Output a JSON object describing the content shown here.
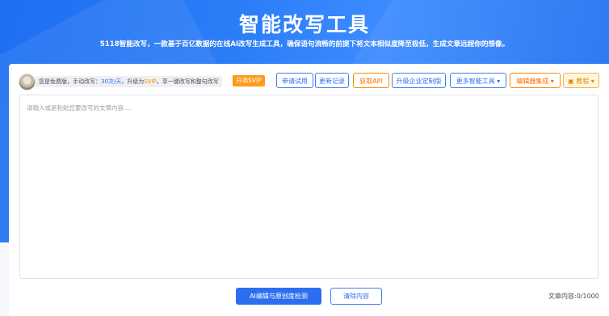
{
  "header": {
    "title": "智能改写工具",
    "subtitle": "5118智能改写，一款基于百亿数据的在线AI改写生成工具，确保语句流畅的前提下将文本相似度降至极低，生成文章远超你的想像。"
  },
  "notice": {
    "prefix": "您是免费版，手动改写：",
    "quota": "30次/天",
    "mid": "，升级为",
    "vip": "SVIP",
    "suffix": "，享一键改写和整句改写"
  },
  "toolbar": {
    "open_vip": "开通SVIP",
    "apply_trial": "申请试用",
    "changelog": "更新记录",
    "get_api": "获取API",
    "enterprise": "升级企业定制版",
    "more_tools": "更多智能工具",
    "editor_integration": "编辑器集成",
    "tutorial": "教程"
  },
  "editor": {
    "placeholder": "请输入或是粘贴您要改写的文章内容...."
  },
  "actions": {
    "ai_edit_check": "AI编辑与原创度检测",
    "clear": "清除内容",
    "char_count": "文章内容:0/1000"
  },
  "colors": {
    "brand_blue": "#2b6ff0",
    "accent_orange": "#ff8a00"
  },
  "icons": {
    "tutorial": "book-icon",
    "dropdown": "chevron-down-icon"
  }
}
